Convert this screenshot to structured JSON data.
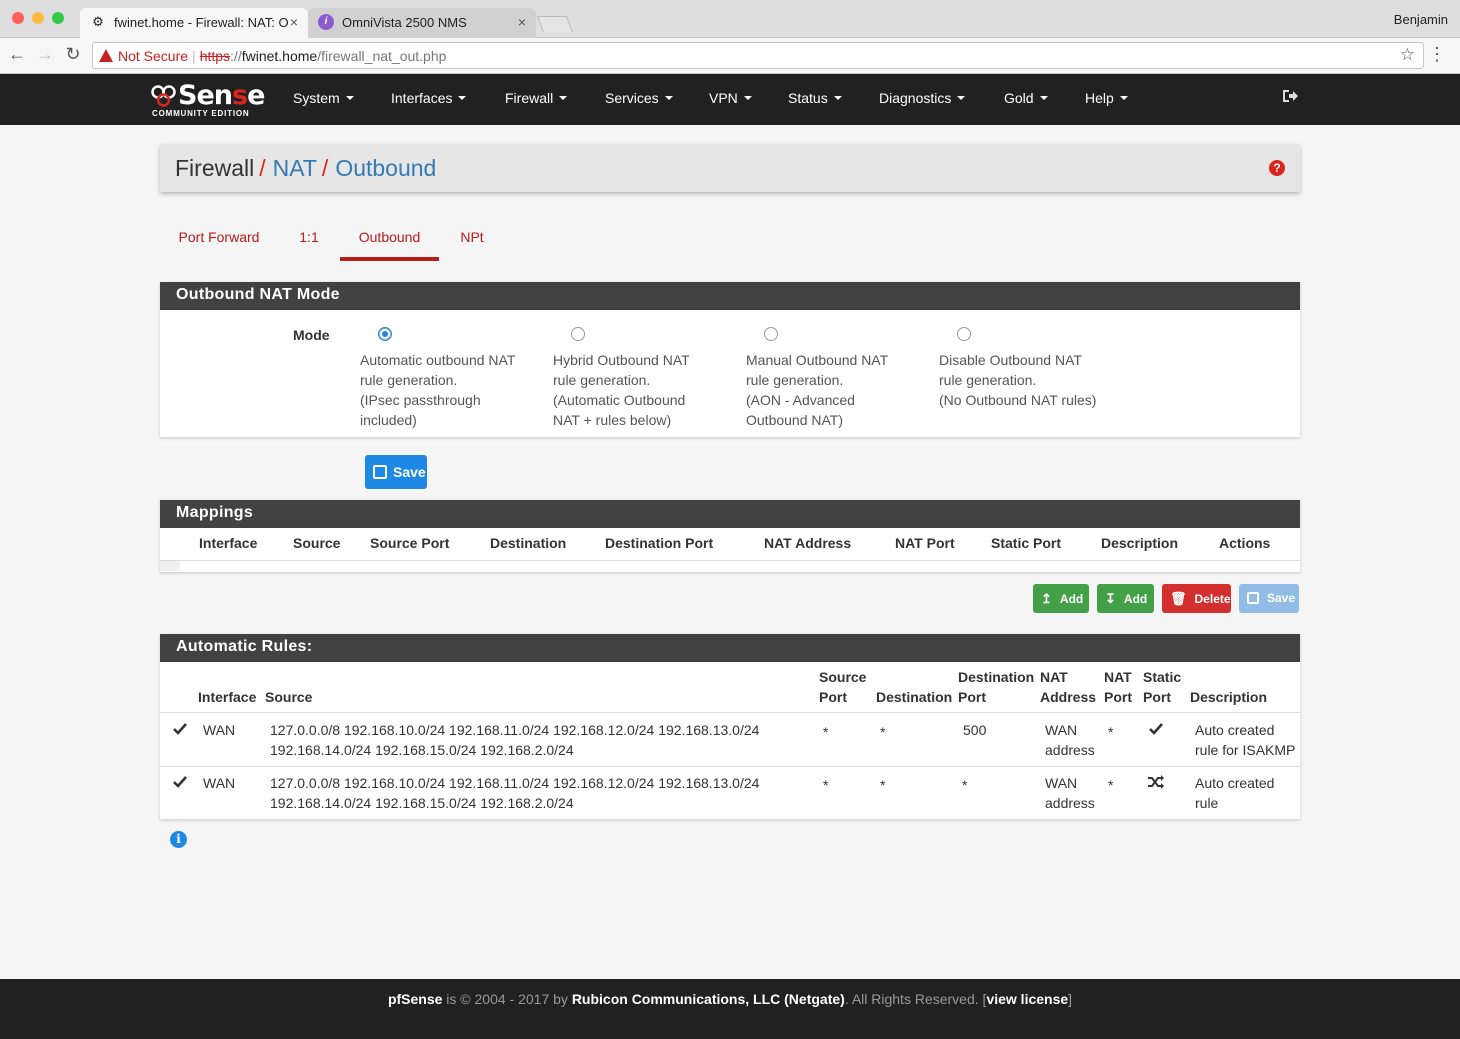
{
  "browser": {
    "tabs": [
      {
        "title": "fwinet.home - Firewall: NAT: O",
        "active": true
      },
      {
        "title": "OmniVista 2500 NMS",
        "active": false
      }
    ],
    "profile": "Benjamin",
    "address": {
      "warning": "Not Secure",
      "scheme": "https",
      "host": "fwinet.home",
      "path": "/firewall_nat_out.php"
    }
  },
  "nav": {
    "logo_text_1": "Sen",
    "logo_text_red": "s",
    "logo_text_2": "e",
    "logo_sub": "COMMUNITY EDITION",
    "items": [
      "System",
      "Interfaces",
      "Firewall",
      "Services",
      "VPN",
      "Status",
      "Diagnostics",
      "Gold",
      "Help"
    ]
  },
  "breadcrumb": {
    "part1": "Firewall",
    "part2": "NAT",
    "part3": "Outbound",
    "separator": "/"
  },
  "tabs": [
    "Port Forward",
    "1:1",
    "Outbound",
    "NPt"
  ],
  "mode_panel": {
    "title": "Outbound NAT Mode",
    "label": "Mode",
    "options": [
      {
        "lines": [
          "Automatic outbound NAT",
          "rule generation.",
          "(IPsec passthrough",
          "included)"
        ],
        "selected": true
      },
      {
        "lines": [
          "Hybrid Outbound NAT",
          "rule generation.",
          "(Automatic Outbound",
          "NAT + rules below)"
        ],
        "selected": false
      },
      {
        "lines": [
          "Manual Outbound NAT",
          "rule generation.",
          "(AON - Advanced",
          "Outbound NAT)"
        ],
        "selected": false
      },
      {
        "lines": [
          "Disable Outbound NAT",
          "rule generation.",
          "(No Outbound NAT rules)"
        ],
        "selected": false
      }
    ],
    "save_label": "Save"
  },
  "mappings": {
    "title": "Mappings",
    "columns": [
      "Interface",
      "Source",
      "Source Port",
      "Destination",
      "Destination Port",
      "NAT Address",
      "NAT Port",
      "Static Port",
      "Description",
      "Actions"
    ],
    "buttons": {
      "add1": "Add",
      "add2": "Add",
      "delete": "Delete",
      "save": "Save"
    }
  },
  "auto_rules": {
    "title": "Automatic Rules:",
    "columns": {
      "interface": "Interface",
      "source": "Source",
      "source_port_1": "Source",
      "source_port_2": "Port",
      "destination": "Destination",
      "dest_port_1": "Destination",
      "dest_port_2": "Port",
      "nat_address_1": "NAT",
      "nat_address_2": "Address",
      "nat_port_1": "NAT",
      "nat_port_2": "Port",
      "static_port_1": "Static",
      "static_port_2": "Port",
      "description": "Description"
    },
    "rows": [
      {
        "interface": "WAN",
        "source_1": "127.0.0.0/8 192.168.10.0/24 192.168.11.0/24 192.168.12.0/24 192.168.13.0/24",
        "source_2": "192.168.14.0/24 192.168.15.0/24 192.168.2.0/24",
        "source_port": "*",
        "destination": "*",
        "dest_port": "500",
        "nat_address_1": "WAN",
        "nat_address_2": "address",
        "nat_port": "*",
        "static_icon": "check-icon",
        "description_1": "Auto created",
        "description_2": "rule for ISAKMP"
      },
      {
        "interface": "WAN",
        "source_1": "127.0.0.0/8 192.168.10.0/24 192.168.11.0/24 192.168.12.0/24 192.168.13.0/24",
        "source_2": "192.168.14.0/24 192.168.15.0/24 192.168.2.0/24",
        "source_port": "*",
        "destination": "*",
        "dest_port": "*",
        "nat_address_1": "WAN",
        "nat_address_2": "address",
        "nat_port": "*",
        "static_icon": "shuffle-icon",
        "description_1": "Auto created",
        "description_2": "rule"
      }
    ]
  },
  "footer": {
    "brand": "pfSense",
    "text1": " is © 2004 - 2017 by ",
    "company": "Rubicon Communications, LLC (Netgate)",
    "text2": ". All Rights Reserved. [",
    "license": "view license",
    "text3": "]"
  },
  "colors": {
    "accent_red": "#b71c1c",
    "primary_blue": "#1e88e5",
    "success_green": "#43a047",
    "danger_red": "#d32f2f",
    "navbar": "#212121",
    "panel_head": "#424242"
  }
}
